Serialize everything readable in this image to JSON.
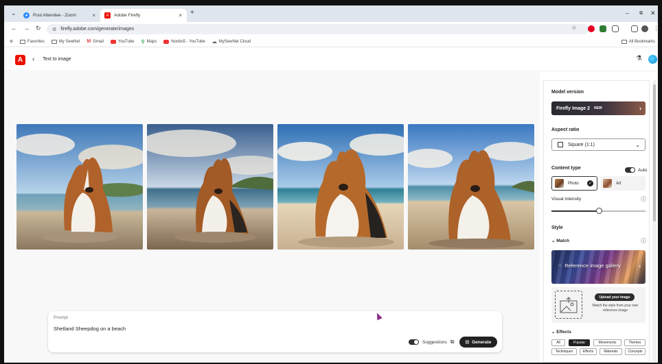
{
  "browser": {
    "tabs": [
      {
        "title": "Post Attendee - Zoom",
        "favicon": "zoom-icon",
        "color": "#2d8cff"
      },
      {
        "title": "Adobe Firefly",
        "favicon": "adobe-icon",
        "color": "#eb1000"
      }
    ],
    "new_tab": "+",
    "window_controls": [
      "–",
      "⧉",
      "✕"
    ],
    "url": "firefly.adobe.com/generate/images",
    "bookmarks": [
      "Favorites",
      "My SewNet",
      "Gmail",
      "YouTube",
      "Maps",
      "Noobs5 - YouTube",
      "MySewNet Cloud"
    ],
    "all_bookmarks": "All Bookmarks"
  },
  "app": {
    "logo_letter": "A",
    "page_title": "Text to image",
    "back_glyph": "‹"
  },
  "canvas": {
    "images": [
      {
        "name": "generated-image-1"
      },
      {
        "name": "generated-image-2"
      },
      {
        "name": "generated-image-3"
      },
      {
        "name": "generated-image-4"
      }
    ],
    "prompt": {
      "label": "Prompt",
      "value": "Shetland Sheepdog on a beach",
      "suggestions_label": "Suggestions",
      "suggestions_on": true,
      "generate_label": "Generate"
    }
  },
  "panel": {
    "model_version": {
      "heading": "Model version",
      "value": "Firefly Image 2",
      "badge": "NEW"
    },
    "aspect_ratio": {
      "heading": "Aspect ratio",
      "value": "Square (1:1)"
    },
    "content_type": {
      "heading": "Content type",
      "auto_label": "Auto",
      "auto_on": true,
      "options": [
        "Photo",
        "Art"
      ],
      "selected": "Photo"
    },
    "visual_intensity": {
      "heading": "Visual intensity",
      "value": 0.5
    },
    "style": {
      "heading": "Style",
      "match_label": "Match",
      "reference_gallery_label": "Reference image gallery",
      "upload_button": "Upload your image",
      "upload_hint": "Match the style from your own reference image"
    },
    "effects": {
      "heading": "Effects",
      "row1": [
        "All",
        "Popular",
        "Movements",
        "Themes"
      ],
      "row2": [
        "Techniques",
        "Effects",
        "Materials",
        "Concepts"
      ],
      "active": "Popular"
    }
  },
  "colors": {
    "accent": "#eb1000",
    "dark_button": "#222222",
    "tabstrip": "#dfe6ee"
  }
}
